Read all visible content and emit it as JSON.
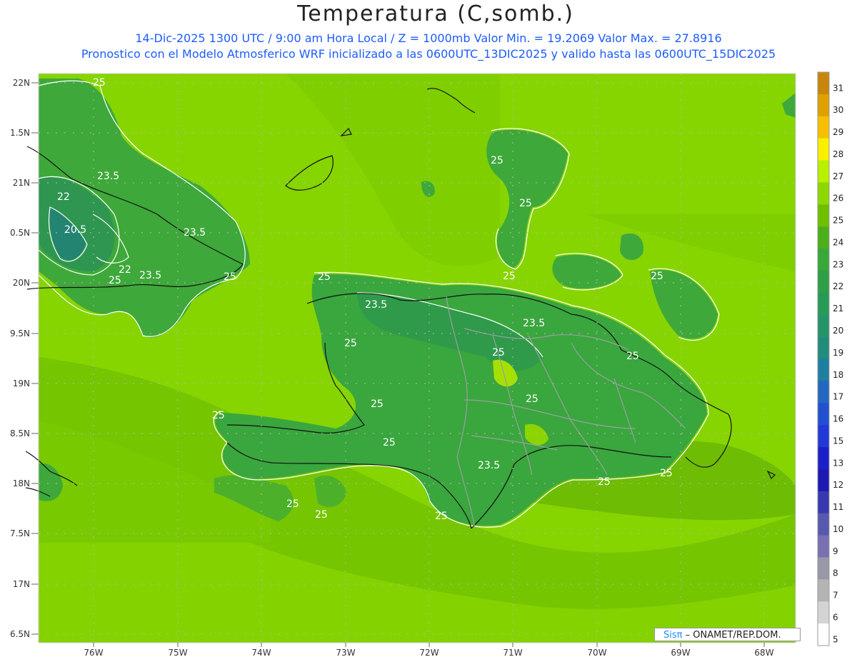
{
  "header": {
    "title": "Temperatura (C,somb.)",
    "line1": "14-Dic-2025  1300 UTC / 9:00 am Hora Local / Z = 1000mb   Valor Min. = 19.2069  Valor Max. = 27.8916",
    "line2": "Pronostico con el Modelo Atmosferico WRF inicializado a las 0600UTC_13DIC2025 y valido hasta las  0600UTC_15DIC2025"
  },
  "axes": {
    "lat_labels": [
      "22N",
      "1.5N",
      "21N",
      "0.5N",
      "20N",
      "9.5N",
      "19N",
      "8.5N",
      "18N",
      "7.5N",
      "17N",
      "6.5N"
    ],
    "lon_labels": [
      "76W",
      "75W",
      "74W",
      "73W",
      "72W",
      "71W",
      "70W",
      "69W",
      "68W"
    ]
  },
  "colorbar": {
    "labels": [
      "31",
      "30",
      "29",
      "28",
      "27",
      "26",
      "25",
      "24",
      "23",
      "22",
      "21",
      "20",
      "19",
      "18",
      "17",
      "16",
      "15",
      "13",
      "12",
      "11",
      "10",
      "9",
      "8",
      "7",
      "6",
      "5"
    ],
    "colors": [
      "#c8860a",
      "#e0a000",
      "#f6c000",
      "#f8f000",
      "#b8f000",
      "#8cd800",
      "#6fbe00",
      "#4caf1a",
      "#38a838",
      "#2e9e48",
      "#289a58",
      "#259468",
      "#208c7c",
      "#1e7fa0",
      "#2268c0",
      "#2250d0",
      "#2238d8",
      "#1c20c8",
      "#1e18b4",
      "#3838b0",
      "#5858b0",
      "#7870b0",
      "#9898a8",
      "#b4b4b4",
      "#d4d4d4",
      "#ffffff"
    ]
  },
  "contour_labels": [
    {
      "text": "25"
    },
    {
      "text": "23.5"
    },
    {
      "text": "22"
    },
    {
      "text": "20.5"
    },
    {
      "text": "23.5"
    },
    {
      "text": "22"
    },
    {
      "text": "23.5"
    },
    {
      "text": "25"
    },
    {
      "text": "25"
    },
    {
      "text": "25"
    },
    {
      "text": "25"
    },
    {
      "text": "25"
    },
    {
      "text": "25"
    },
    {
      "text": "25"
    },
    {
      "text": "23.5"
    },
    {
      "text": "23.5"
    },
    {
      "text": "25"
    },
    {
      "text": "25"
    },
    {
      "text": "25"
    },
    {
      "text": "25"
    },
    {
      "text": "25"
    },
    {
      "text": "25"
    },
    {
      "text": "25"
    },
    {
      "text": "25"
    },
    {
      "text": "23.5"
    },
    {
      "text": "25"
    },
    {
      "text": "25"
    },
    {
      "text": "25"
    },
    {
      "text": "25"
    },
    {
      "text": "25"
    }
  ],
  "credit": {
    "sis": "Sisπ",
    "org": " – ONAMET/REP.DOM."
  }
}
